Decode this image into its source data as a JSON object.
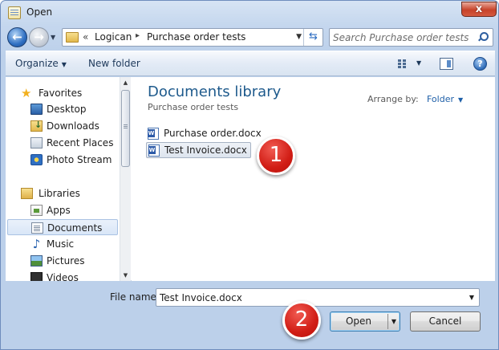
{
  "window": {
    "title": "Open",
    "close_glyph": "x"
  },
  "address": {
    "chevron": "«",
    "crumbs": [
      "Logican",
      "Purchase order tests"
    ],
    "separator": "▸"
  },
  "search": {
    "placeholder": "Search Purchase order tests"
  },
  "toolbar": {
    "organize_label": "Organize",
    "new_folder_label": "New folder",
    "help_glyph": "?"
  },
  "sidebar": {
    "items": [
      {
        "label": "Favorites",
        "icon": "star-icon",
        "group": true
      },
      {
        "label": "Desktop",
        "icon": "desktop-icon"
      },
      {
        "label": "Downloads",
        "icon": "downloads-icon"
      },
      {
        "label": "Recent Places",
        "icon": "recent-places-icon"
      },
      {
        "label": "Photo Stream",
        "icon": "photo-stream-icon"
      },
      {
        "label": "Libraries",
        "icon": "libraries-icon",
        "group": true
      },
      {
        "label": "Apps",
        "icon": "apps-icon"
      },
      {
        "label": "Documents",
        "icon": "documents-icon",
        "selected": true
      },
      {
        "label": "Music",
        "icon": "music-icon"
      },
      {
        "label": "Pictures",
        "icon": "pictures-icon"
      },
      {
        "label": "Videos",
        "icon": "videos-icon"
      }
    ]
  },
  "content": {
    "library_title": "Documents library",
    "library_subtitle": "Purchase order tests",
    "arrange_label": "Arrange by:",
    "arrange_value": "Folder",
    "files": [
      {
        "name": "Purchase order.docx",
        "icon": "word-document-icon",
        "selected": false
      },
      {
        "name": "Test Invoice.docx",
        "icon": "word-document-icon",
        "selected": true
      }
    ]
  },
  "annotations": {
    "step1": "1",
    "step2": "2"
  },
  "bottom": {
    "file_name_label": "File name:",
    "file_name_value": "Test Invoice.docx",
    "open_label": "Open",
    "cancel_label": "Cancel"
  },
  "colors": {
    "accent": "#1e5a8c",
    "link": "#1e5fa8",
    "badge": "#d11d15",
    "close": "#c7432a"
  }
}
